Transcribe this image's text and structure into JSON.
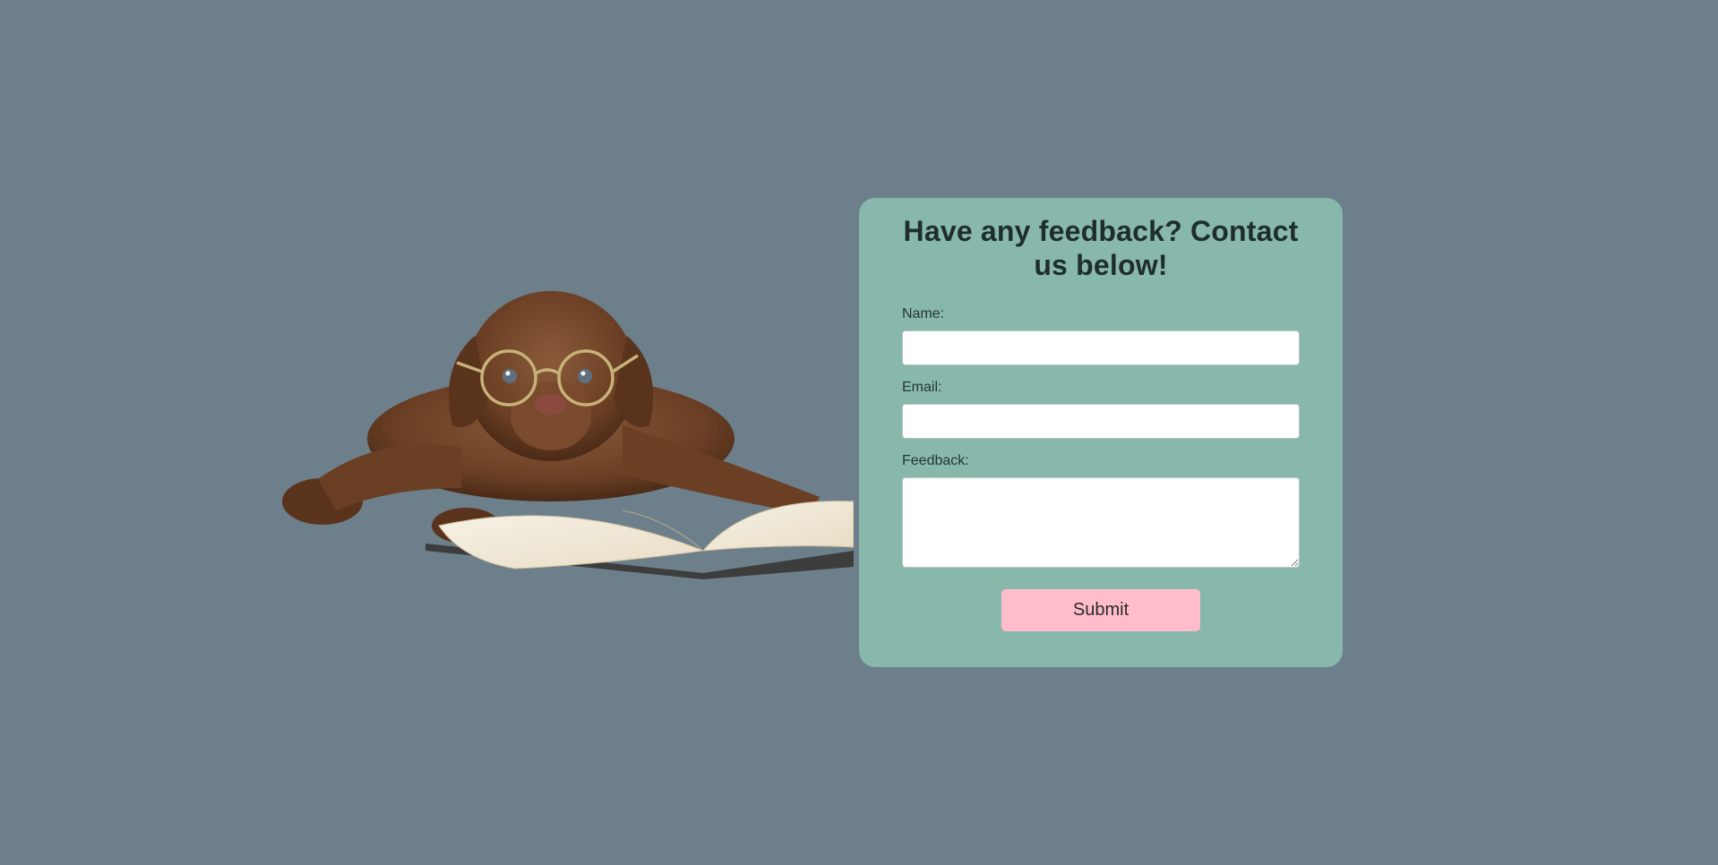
{
  "colors": {
    "page_background": "#6c7f8a",
    "card_background": "#88b8ac",
    "button_background": "#ffbdcb",
    "heading_text": "#1f2d2f"
  },
  "illustration": {
    "icon": "puppy-with-glasses-reading-book-image"
  },
  "form": {
    "title": "Have any feedback? Contact us below!",
    "name_label": "Name:",
    "name_value": "",
    "email_label": "Email:",
    "email_value": "",
    "feedback_label": "Feedback:",
    "feedback_value": "",
    "submit_label": "Submit"
  }
}
